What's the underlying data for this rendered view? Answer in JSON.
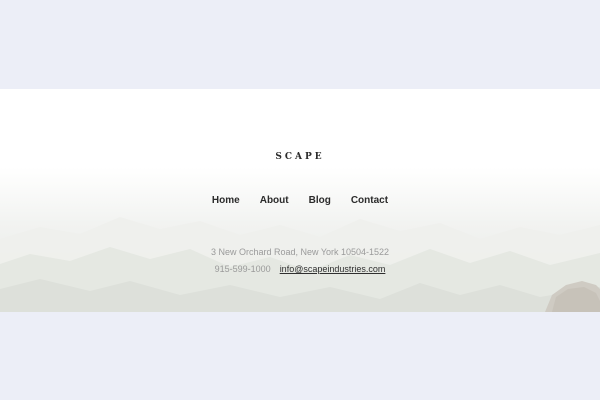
{
  "footer": {
    "logo": "SCAPE",
    "nav": [
      {
        "label": "Home"
      },
      {
        "label": "About"
      },
      {
        "label": "Blog"
      },
      {
        "label": "Contact"
      }
    ],
    "address": "3 New Orchard Road, New York 10504-1522",
    "phone": "915-599-1000",
    "email": "info@scapeindustries.com"
  },
  "colors": {
    "page_background": "#eceef7",
    "footer_background": "#ffffff",
    "nav_text": "#2b2b2b",
    "muted_text": "#9a9a9a"
  }
}
